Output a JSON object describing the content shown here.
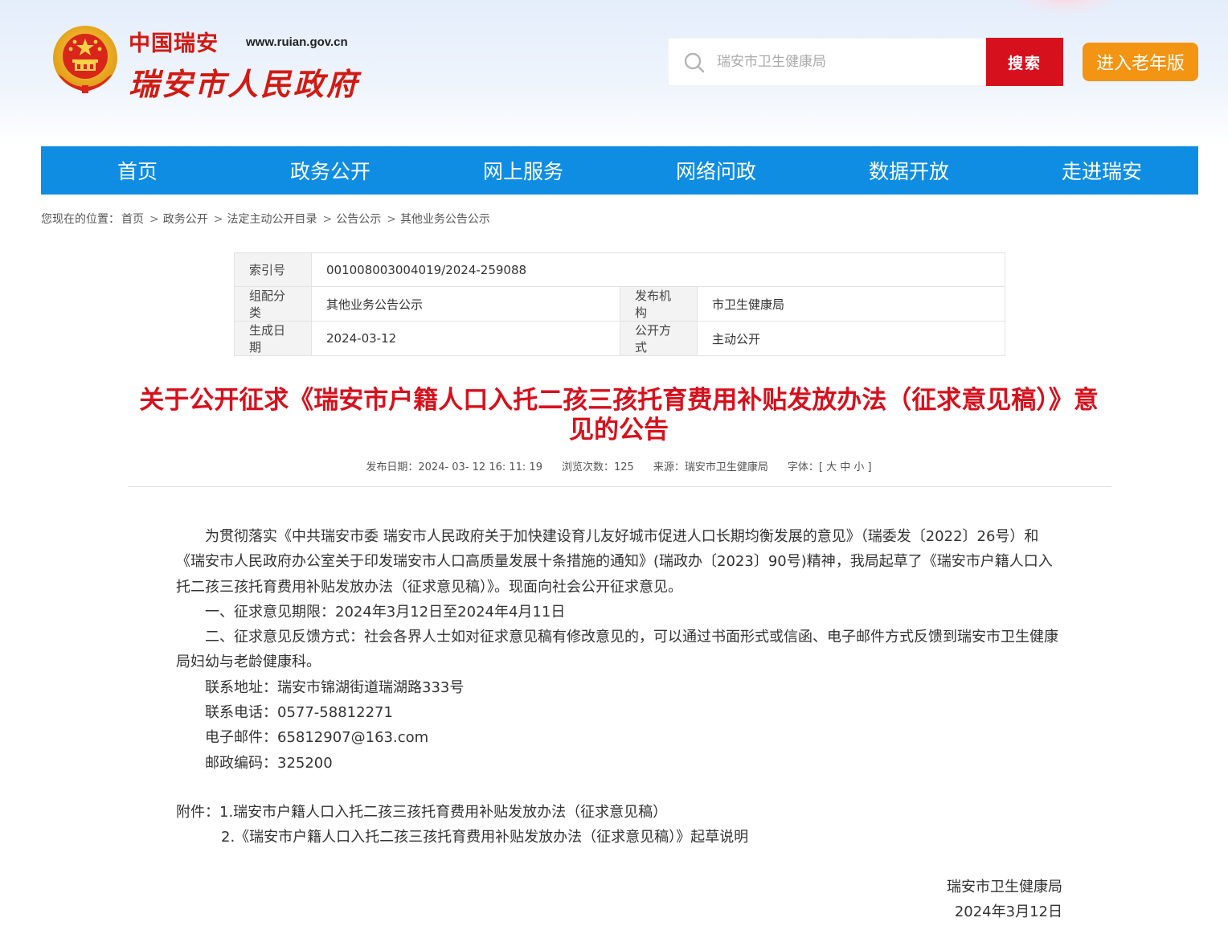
{
  "header": {
    "logo_top": "中国瑞安",
    "logo_url": "www.ruian.gov.cn",
    "logo_main": "瑞安市人民政府",
    "search_placeholder": "瑞安市卫生健康局",
    "search_button": "搜索",
    "elder_button": "进入老年版"
  },
  "nav": [
    "首页",
    "政务公开",
    "网上服务",
    "网络问政",
    "数据开放",
    "走进瑞安"
  ],
  "breadcrumb": {
    "prefix": "您现在的位置：",
    "items": [
      "首页",
      "政务公开",
      "法定主动公开目录",
      "公告公示",
      "其他业务公告公示"
    ],
    "separator": ">"
  },
  "meta": {
    "index_label": "索引号",
    "index_value": "001008003004019/2024-259088",
    "category_label": "组配分类",
    "category_value": "其他业务公告公示",
    "publisher_label": "发布机构",
    "publisher_value": "市卫生健康局",
    "date_label": "生成日期",
    "date_value": "2024-03-12",
    "mode_label": "公开方式",
    "mode_value": "主动公开"
  },
  "article": {
    "title": "关于公开征求《瑞安市户籍人口入托二孩三孩托育费用补贴发放办法（征求意见稿）》意见的公告",
    "publish_label": "发布日期：",
    "publish_value": "2024- 03- 12 16: 11: 19",
    "views_label": "浏览次数：",
    "views_value": "125",
    "source_label": "来源：",
    "source_value": "瑞安市卫生健康局",
    "font_label": "字体：[",
    "font_large": "大",
    "font_medium": "中",
    "font_small": "小",
    "font_end": "]",
    "paragraphs": [
      "为贯彻落实《中共瑞安市委 瑞安市人民政府关于加快建设育儿友好城市促进人口长期均衡发展的意见》（瑞委发〔2022〕26号）和《瑞安市人民政府办公室关于印发瑞安市人口高质量发展十条措施的通知》(瑞政办〔2023〕90号)精神，我局起草了《瑞安市户籍人口入托二孩三孩托育费用补贴发放办法（征求意见稿）》。现面向社会公开征求意见。",
      "一、征求意见期限：2024年3月12日至2024年4月11日",
      "二、征求意见反馈方式：社会各界人士如对征求意见稿有修改意见的，可以通过书面形式或信函、电子邮件方式反馈到瑞安市卫生健康局妇幼与老龄健康科。",
      "联系地址：瑞安市锦湖街道瑞湖路333号",
      "联系电话：0577-58812271",
      "电子邮件：65812907@163.com",
      "邮政编码：325200"
    ],
    "attachment_1": "附件：1.瑞安市户籍人口入托二孩三孩托育费用补贴发放办法（征求意见稿）",
    "attachment_2": "2.《瑞安市户籍人口入托二孩三孩托育费用补贴发放办法（征求意见稿）》起草说明",
    "sign_org": "瑞安市卫生健康局",
    "sign_date": "2024年3月12日"
  },
  "colors": {
    "nav_blue": "#0f8de3",
    "search_red": "#d6111d",
    "elder_orange": "#f39413",
    "title_red": "#d6111d"
  }
}
